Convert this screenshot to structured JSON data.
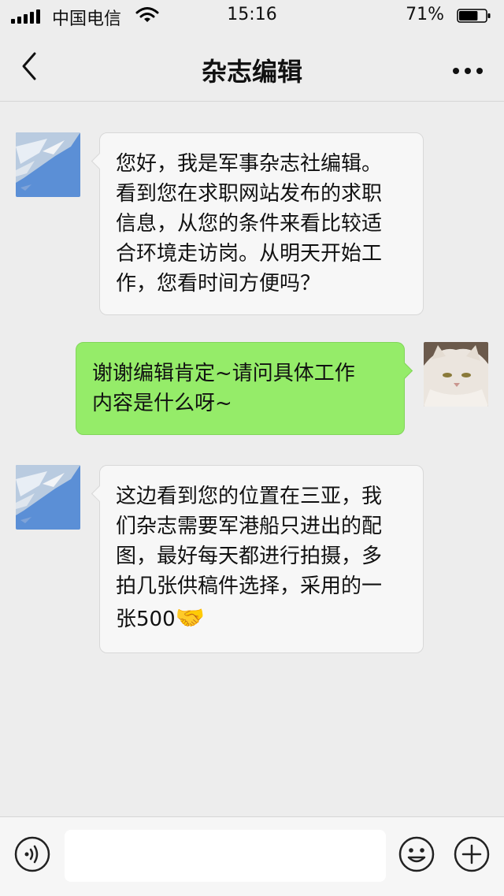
{
  "status_bar": {
    "carrier": "中国电信",
    "time": "15:16",
    "battery_percent": "71%",
    "battery_level": 0.71,
    "icons": [
      "signal-icon",
      "wifi-icon",
      "battery-icon"
    ]
  },
  "nav": {
    "title": "杂志编辑",
    "back_icon": "back-chevron-icon",
    "more_icon": "more-dots-icon"
  },
  "messages": [
    {
      "sender": "editor",
      "avatar": "editor-avatar-aerial-coast",
      "lines": [
        "您好，我是军事杂志社编辑。",
        "看到您在求职网站发布的求职",
        "信息，从您的条件来看比较适",
        "合环境走访岗。从明天开始工",
        "作，您看时间方便吗？"
      ]
    },
    {
      "sender": "me",
      "avatar": "user-avatar-white-cat",
      "lines": [
        "谢谢编辑肯定~请问具体工作",
        "内容是什么呀~"
      ]
    },
    {
      "sender": "editor",
      "avatar": "editor-avatar-aerial-coast",
      "lines": [
        "这边看到您的位置在三亚，我",
        "们杂志需要军港船只进出的配",
        "图，最好每天都进行拍摄，多",
        "拍几张供稿件选择，采用的一",
        "张500"
      ],
      "trailing_emoji": "🤝"
    }
  ],
  "input_bar": {
    "text_value": "",
    "icons": [
      "voice-icon",
      "emoji-icon",
      "plus-icon"
    ]
  },
  "colors": {
    "background": "#ededed",
    "incoming_bubble": "#f7f7f7",
    "outgoing_bubble": "#95ec69"
  }
}
